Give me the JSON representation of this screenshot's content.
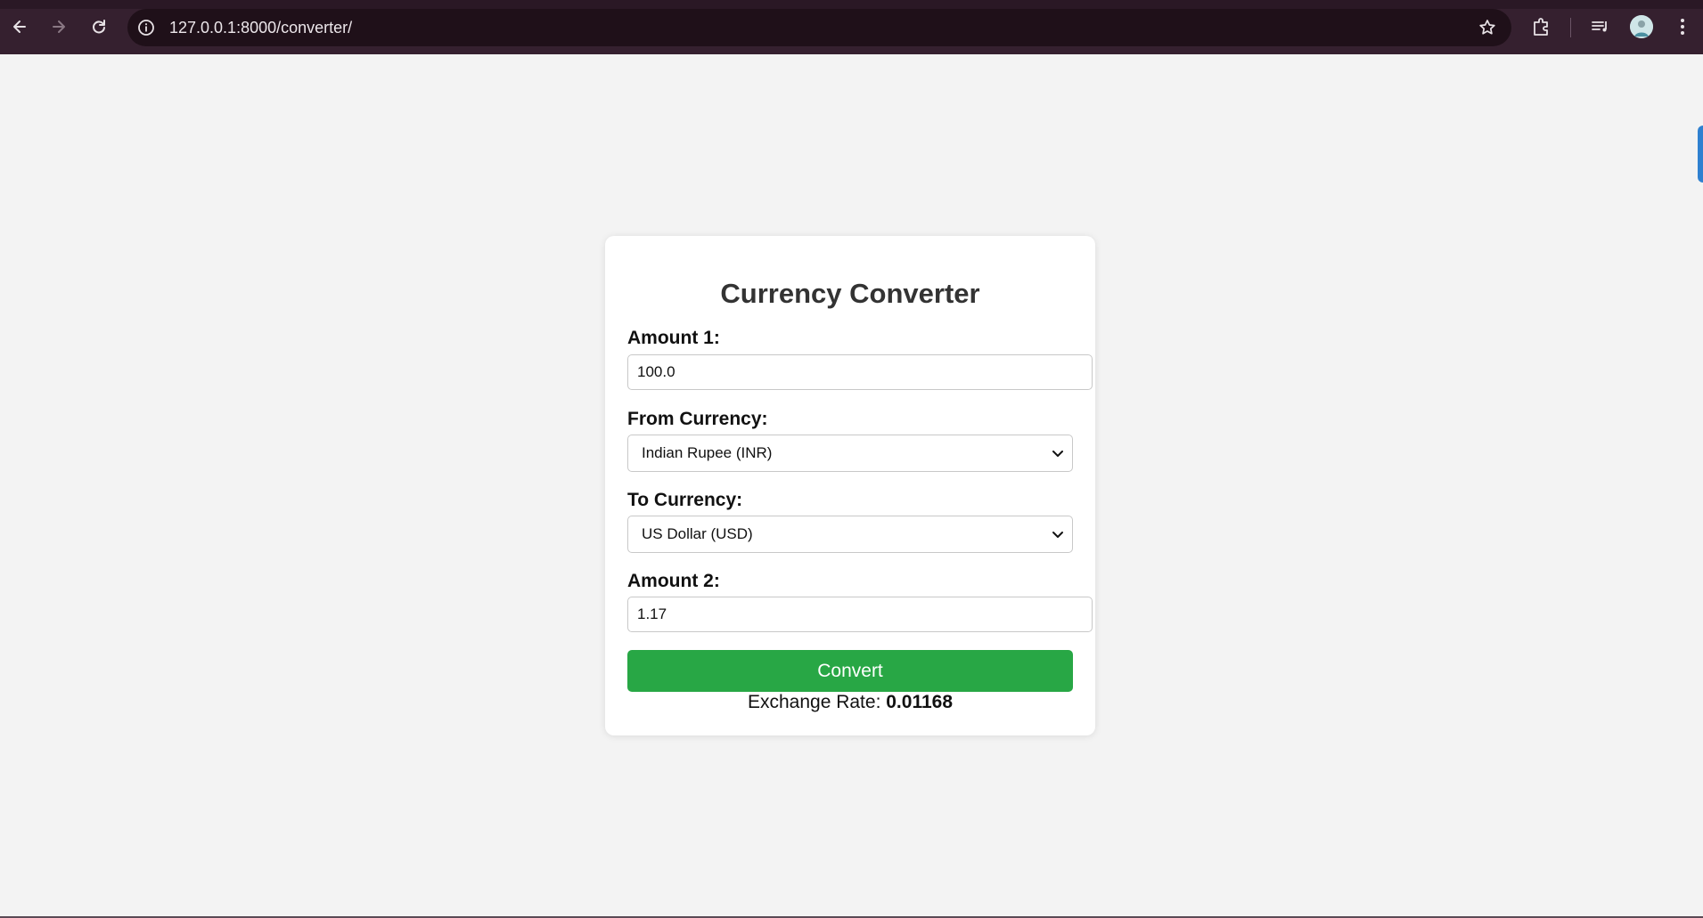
{
  "browser": {
    "url": "127.0.0.1:8000/converter/",
    "icons": [
      "back-arrow-icon",
      "forward-arrow-icon",
      "reload-icon",
      "info-icon",
      "star-icon",
      "extensions-icon",
      "media-controls-icon",
      "avatar",
      "kebab-menu-icon"
    ]
  },
  "converter": {
    "title": "Currency Converter",
    "amount1_label": "Amount 1:",
    "amount1_value": "100.0",
    "from_label": "From Currency:",
    "from_selected": "Indian Rupee (INR)",
    "to_label": "To Currency:",
    "to_selected": "US Dollar (USD)",
    "amount2_label": "Amount 2:",
    "amount2_value": "1.17",
    "convert_label": "Convert",
    "rate_label": "Exchange Rate:",
    "rate_value": "0.01168"
  },
  "colors": {
    "chrome_bg": "#35202f",
    "button_green": "#28a745",
    "page_bg": "#f3f3f3"
  }
}
